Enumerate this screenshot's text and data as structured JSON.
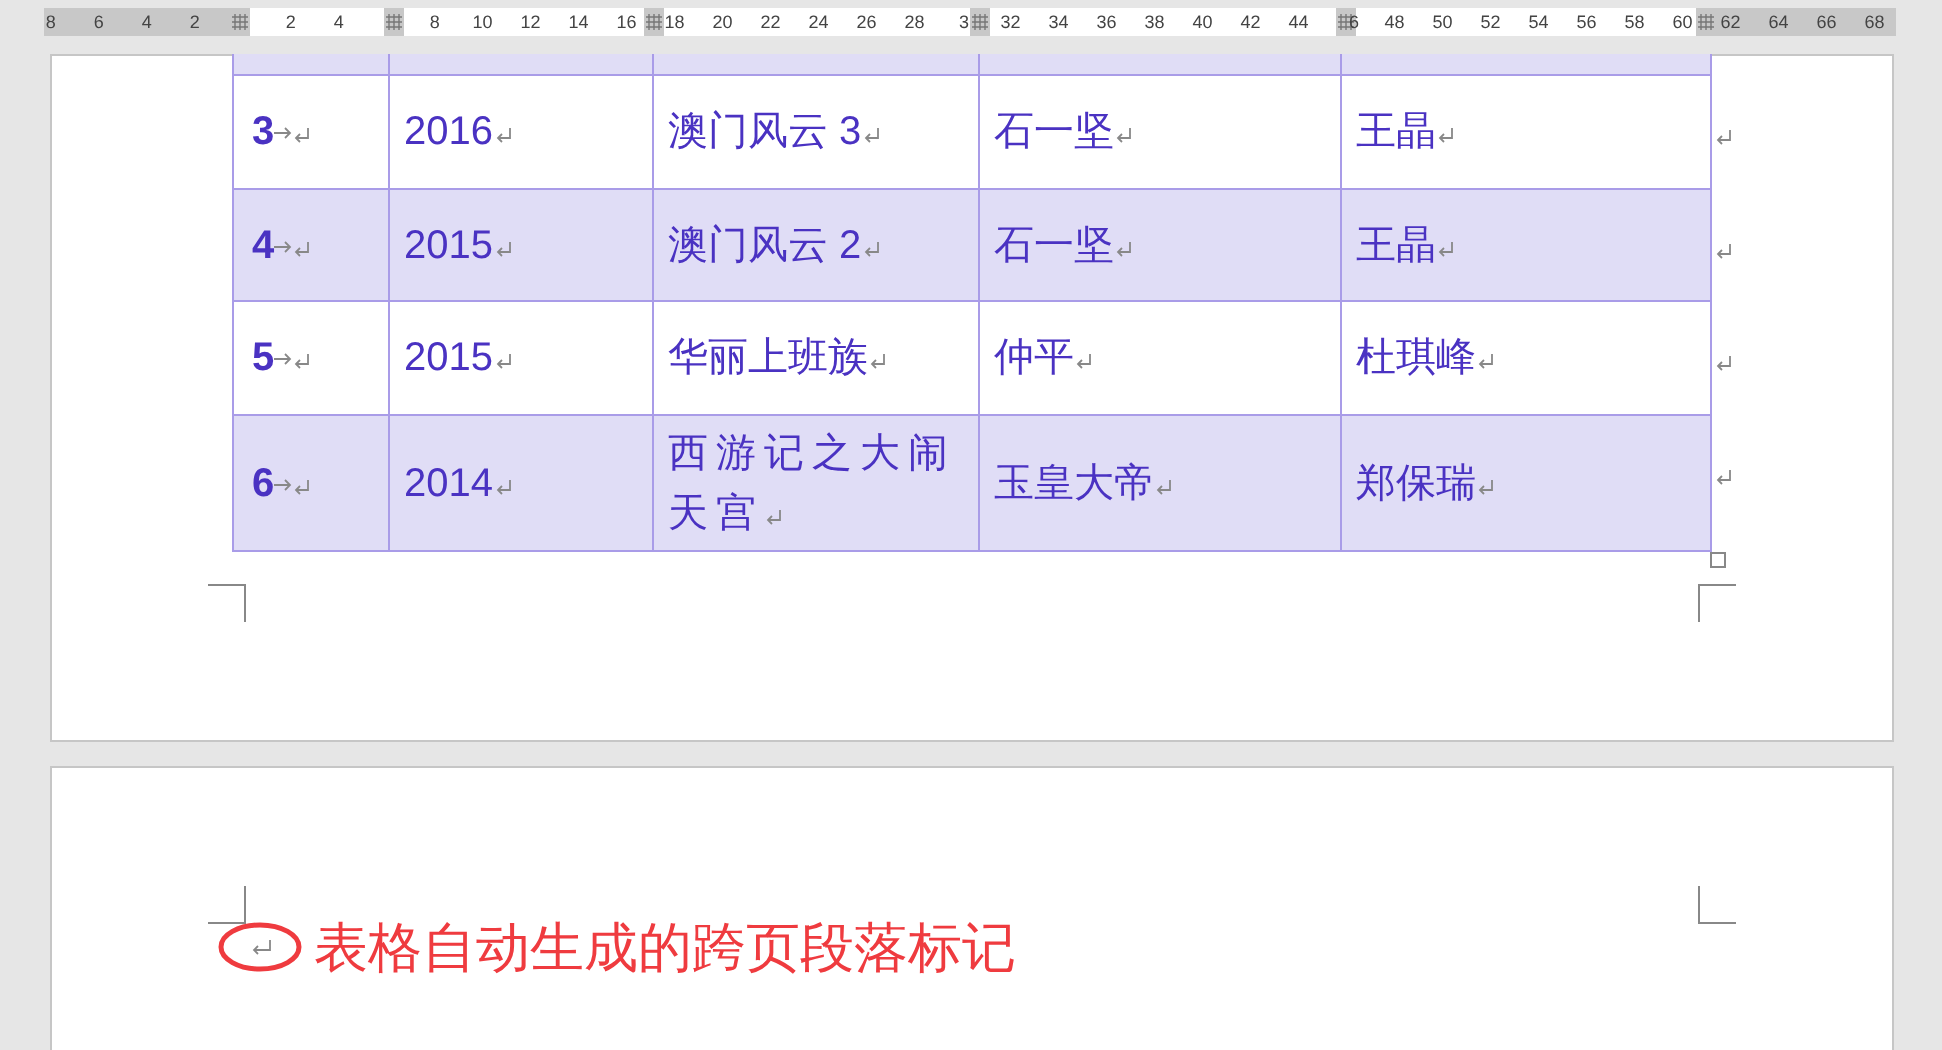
{
  "ruler": {
    "labels": [
      "8",
      "6",
      "4",
      "2",
      "2",
      "4",
      "8",
      "10",
      "12",
      "14",
      "16",
      "18",
      "20",
      "22",
      "24",
      "26",
      "28",
      "3",
      "32",
      "34",
      "36",
      "38",
      "40",
      "42",
      "44",
      "6",
      "48",
      "50",
      "52",
      "54",
      "56",
      "58",
      "60",
      "62",
      "64",
      "66",
      "68"
    ]
  },
  "table": {
    "rows": [
      {
        "cells": [
          "3",
          "2016",
          "澳门风云 3",
          "石一坚",
          "王晶"
        ]
      },
      {
        "cells": [
          "4",
          "2015",
          "澳门风云 2",
          "石一坚",
          "王晶"
        ]
      },
      {
        "cells": [
          "5",
          "2015",
          "华丽上班族",
          "仲平",
          "杜琪峰"
        ]
      },
      {
        "cells": [
          "6",
          "2014",
          "西游记之大闹天宫",
          "玉皇大帝",
          "郑保瑞"
        ]
      }
    ]
  },
  "annotation": {
    "text": "表格自动生成的跨页段落标记"
  }
}
